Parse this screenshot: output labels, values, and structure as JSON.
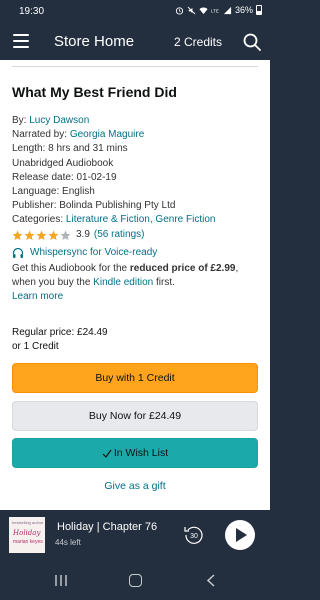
{
  "status_bar": {
    "time": "19:30",
    "battery": "36%",
    "icons": [
      "alarm-icon",
      "mute-icon",
      "wifi-icon",
      "lte-icon",
      "signal-icon",
      "battery-icon"
    ]
  },
  "header": {
    "title": "Store Home",
    "credits": "2 Credits",
    "icons": [
      "menu-icon",
      "search-icon"
    ]
  },
  "book": {
    "title": "What My Best Friend Did",
    "by_label": "By:",
    "author": "Lucy Dawson",
    "narrated_label": "Narrated by:",
    "narrator": "Georgia Maguire",
    "length": "Length: 8 hrs and 31 mins",
    "format": "Unabridged Audiobook",
    "release": "Release date: 01-02-19",
    "language": "Language: English",
    "publisher": "Publisher: Bolinda Publishing Pty Ltd",
    "categories_label": "Categories:",
    "category_1": "Literature & Fiction",
    "category_sep": ",",
    "category_2": "Genre Fiction",
    "rating_value": "3.9",
    "rating_count": "(56 ratings)",
    "rating_stars": 3.9,
    "whispersync": "Whispersync for Voice-ready",
    "offer_prefix": "Get this Audiobook for the ",
    "offer_bold": "reduced price of £2.99",
    "offer_middle": ", when you buy the ",
    "offer_link": "Kindle edition",
    "offer_suffix": " first.",
    "learn_more": "Learn more"
  },
  "pricing": {
    "regular": "Regular price: £24.49",
    "credit": "or 1 Credit"
  },
  "buttons": {
    "buy_credit": "Buy with 1 Credit",
    "buy_now": "Buy Now for £24.49",
    "wish_list": "In Wish List",
    "gift": "Give as a gift"
  },
  "player": {
    "title": "Holiday | Chapter 76",
    "remaining": "44s left",
    "rewind_seconds": "30",
    "cover_tag": "bestselling author",
    "cover_title": "Holiday",
    "cover_author": "marian keyes"
  },
  "nav": {
    "icons": [
      "recents-icon",
      "home-icon",
      "back-icon"
    ]
  },
  "colors": {
    "header_bg": "#232f3e",
    "link": "#007185",
    "credit_button": "#ffa41c",
    "wish_button": "#1ba9aa",
    "star": "#f5a623"
  }
}
